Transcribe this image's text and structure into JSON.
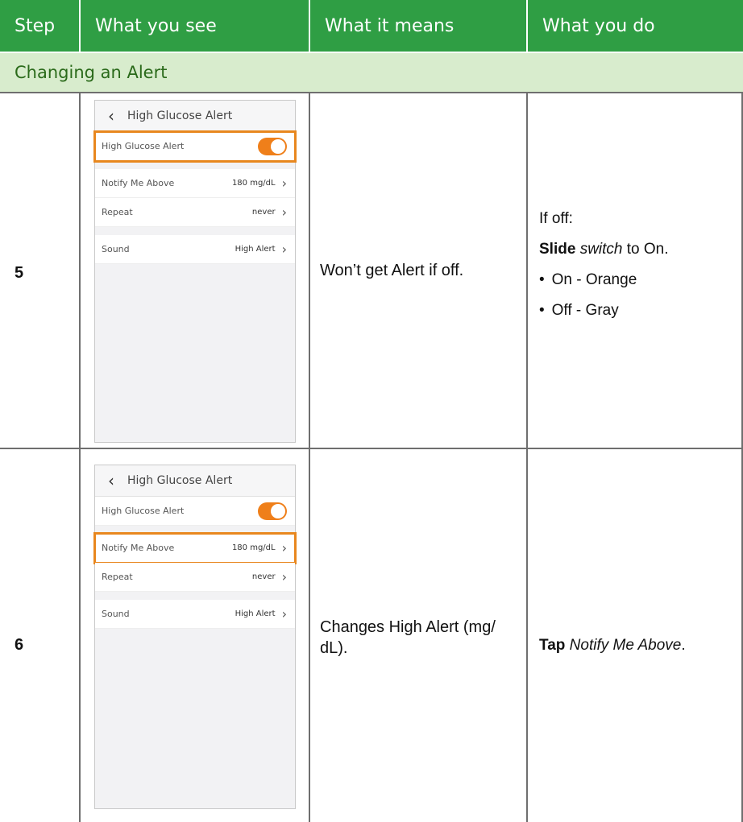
{
  "header": {
    "col_step": "Step",
    "col_see": "What you see",
    "col_means": "What it means",
    "col_do": "What you do"
  },
  "section_title": "Changing an Alert",
  "rows": [
    {
      "step": "5",
      "means": "Won’t get Alert if off.",
      "do_intro": "If off:",
      "do_action_verb": "Slide",
      "do_action_obj": "switch",
      "do_action_rest": " to On.",
      "bullets": [
        "On - Orange",
        "Off - Gray"
      ],
      "phone": {
        "title": "High Glucose Alert",
        "rows": [
          {
            "label": "High Glucose Alert",
            "value": "",
            "toggle": true
          },
          {
            "label": "Notify Me Above",
            "value": "180 mg/dL"
          },
          {
            "label": "Repeat",
            "value": "never"
          },
          {
            "label": "Sound",
            "value": "High Alert"
          }
        ]
      }
    },
    {
      "step": "6",
      "means": "Changes High Alert (mg/ dL).",
      "do_action_verb": "Tap",
      "do_action_obj": "Notify Me Above",
      "do_action_rest": ".",
      "phone": {
        "title": "High Glucose Alert",
        "rows": [
          {
            "label": "High Glucose Alert",
            "value": "",
            "toggle": true
          },
          {
            "label": "Notify Me Above",
            "value": "180 mg/dL"
          },
          {
            "label": "Repeat",
            "value": "never"
          },
          {
            "label": "Sound",
            "value": "High Alert"
          }
        ]
      }
    }
  ],
  "colors": {
    "header_bg": "#2f9e44",
    "section_bg": "#d8eccd",
    "highlight": "#e8871e",
    "toggle_on": "#ef7f1a"
  }
}
